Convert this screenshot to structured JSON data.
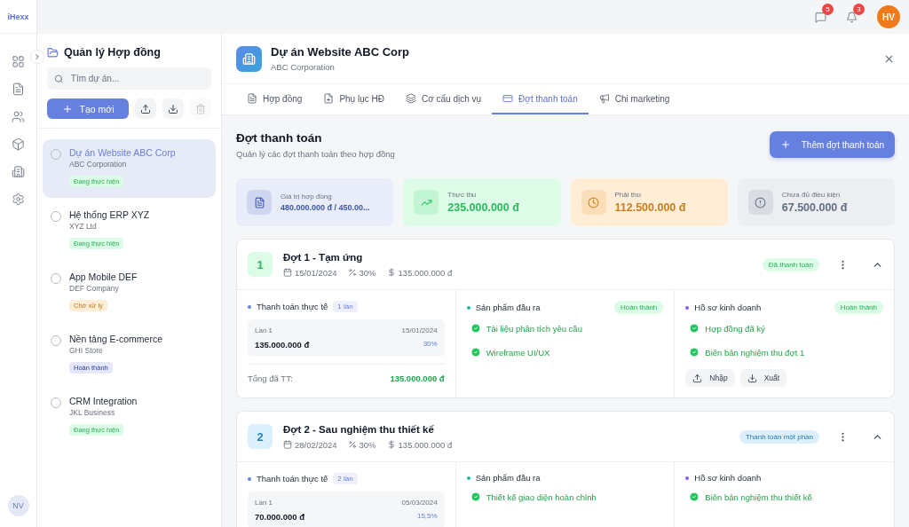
{
  "logo": "iHexx",
  "rail": {
    "items": [
      {
        "kind": "grid",
        "selected": false
      },
      {
        "kind": "document",
        "selected": false
      },
      {
        "kind": "users",
        "selected": false
      },
      {
        "kind": "box",
        "selected": false
      },
      {
        "kind": "building",
        "selected": false
      },
      {
        "kind": "settings",
        "selected": false
      }
    ],
    "user": "NV"
  },
  "topbar": {
    "messages_count": "5",
    "notifications_count": "3",
    "user": "HV"
  },
  "sidebar": {
    "title": "Quản lý Hợp đồng",
    "search": {
      "placeholder": "Tìm dự án..."
    },
    "create_button": "Tạo mới",
    "projects": [
      {
        "name": "Dự án Website ABC Corp",
        "client": "ABC Corporation",
        "status": "Đang thực hiện",
        "color": "#dcfce7",
        "selected": true,
        "checked": false
      },
      {
        "name": "Hệ thống ERP XYZ",
        "client": "XYZ Ltd",
        "status": "Đang thực hiện",
        "color": "#dcfce7",
        "selected": false,
        "checked": false
      },
      {
        "name": "App Mobile DEF",
        "client": "DEF Company",
        "status": "Chờ xử lý",
        "color": "#ffedd5",
        "selected": false,
        "checked": false
      },
      {
        "name": "Nền tảng E-commerce",
        "client": "GHI Store",
        "status": "Hoàn thành",
        "color": "#e5e8fb",
        "selected": false,
        "checked": false
      },
      {
        "name": "CRM Integration",
        "client": "JKL Business",
        "status": "Đang thực hiện",
        "color": "#dcfce7",
        "selected": false,
        "checked": false
      }
    ]
  },
  "header": {
    "title": "Dự án Website ABC Corp",
    "subtitle": "ABC Corporation"
  },
  "tabs": [
    {
      "label": "Hợp đồng",
      "kind": "contract",
      "selected": false
    },
    {
      "label": "Phụ lục HĐ",
      "kind": "appendix",
      "selected": false
    },
    {
      "label": "Cơ cấu dịch vụ",
      "kind": "layers",
      "selected": false
    },
    {
      "label": "Đợt thanh toán",
      "kind": "payment",
      "selected": true
    },
    {
      "label": "Chi marketing",
      "kind": "marketing",
      "selected": false
    }
  ],
  "section": {
    "title": "Đợt thanh toán",
    "subtitle": "Quản lý các đợt thanh toán theo hợp đồng",
    "add_button": "Thêm đợt thanh toán"
  },
  "stats": [
    {
      "kind": "contract",
      "label": "Giá trị hợp đồng",
      "value": "480.000.000 đ / 450.00...",
      "color": "#e9edfa"
    },
    {
      "kind": "income",
      "label": "Thực thu",
      "value": "235.000.000 đ",
      "color": "#dcfce7"
    },
    {
      "kind": "receivable",
      "label": "Phải thu",
      "value": "112.500.000 đ",
      "color": "#ffedd5"
    },
    {
      "kind": "pending",
      "label": "Chưa đủ điều kiện",
      "value": "67.500.000 đ",
      "color": "#eceef2"
    }
  ],
  "batches": [
    {
      "number": "1",
      "title": "Đợt 1 - Tạm ứng",
      "date": "15/01/2024",
      "percent": "30%",
      "amount": "135.000.000 đ",
      "status": "Đã thanh toán",
      "color": "#dcfce7",
      "expanded": true,
      "payments": {
        "title": "Thanh toán thực tế",
        "count": "1 lần",
        "entries": [
          {
            "label": "Lần 1",
            "date": "15/01/2024",
            "amount": "135.000.000 đ",
            "percent": "30%"
          }
        ],
        "total_label": "Tổng đã TT:",
        "total": "135.000.000 đ"
      },
      "outputs": {
        "title": "Sản phẩm đầu ra",
        "badge": "Hoàn thành",
        "items": [
          "Tài liệu phân tích yêu cầu",
          "Wireframe UI/UX"
        ]
      },
      "documents": {
        "title": "Hồ sơ kinh doanh",
        "badge": "Hoàn thành",
        "items": [
          "Hợp đồng đã ký",
          "Biên bản nghiệm thu đợt 1"
        ],
        "actions": [
          "Nhập",
          "Xuất"
        ]
      }
    },
    {
      "number": "2",
      "title": "Đợt 2 - Sau nghiệm thu thiết kế",
      "date": "28/02/2024",
      "percent": "30%",
      "amount": "135.000.000 đ",
      "status": "Thanh toán một phần",
      "color": "#dbeffc",
      "expanded": true,
      "payments": {
        "title": "Thanh toán thực tế",
        "count": "2 lần",
        "entries": [
          {
            "label": "Lần 1",
            "date": "05/03/2024",
            "amount": "70.000.000 đ",
            "percent": "15,5%"
          }
        ]
      },
      "outputs": {
        "title": "Sản phẩm đầu ra",
        "items": [
          "Thiết kế giao diện hoàn chỉnh"
        ]
      },
      "documents": {
        "title": "Hồ sơ kinh doanh",
        "items": [
          "Biên bản nghiệm thu thiết kế"
        ]
      }
    }
  ]
}
